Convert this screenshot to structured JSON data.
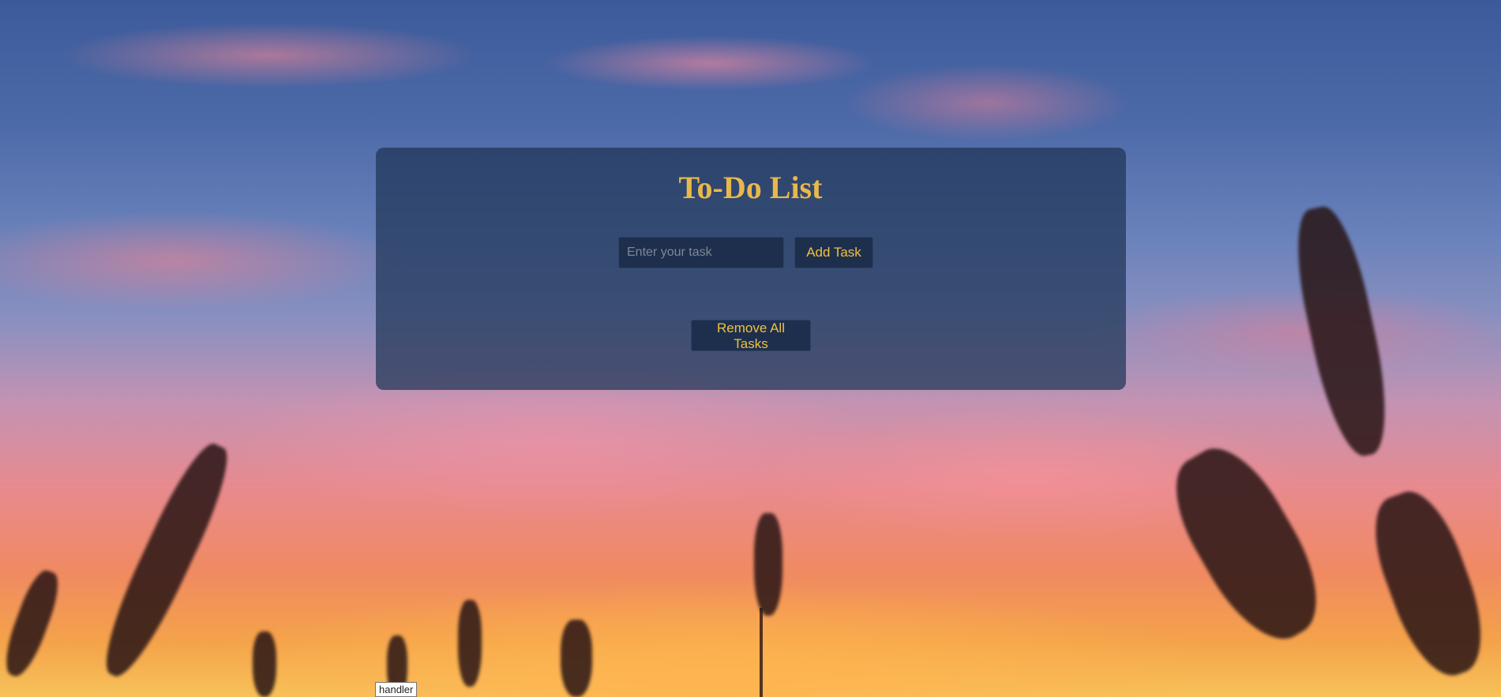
{
  "app": {
    "title": "To-Do List"
  },
  "task_input": {
    "value": "",
    "placeholder": "Enter your task"
  },
  "buttons": {
    "add_task": "Add Task",
    "remove_all": "Remove All Tasks"
  },
  "tooltip": {
    "text": "handler"
  },
  "colors": {
    "title": "#e9b84a",
    "button_text": "#f0c040",
    "panel": "#1e3456"
  }
}
